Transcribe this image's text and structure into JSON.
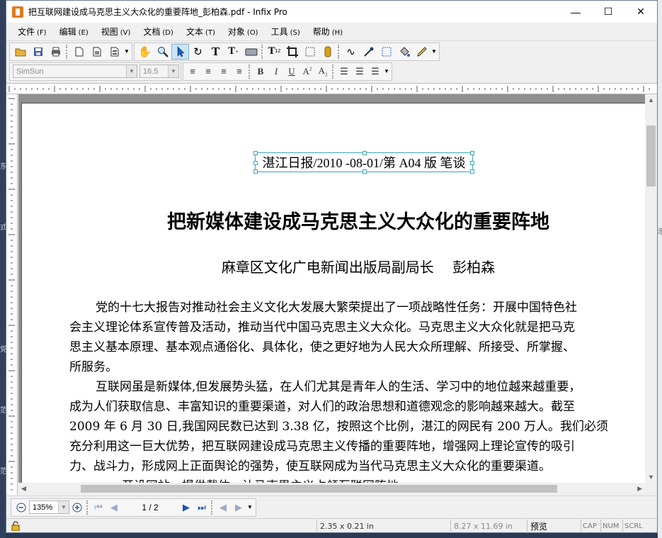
{
  "window": {
    "title": "把互联网建设成马克思主义大众化的重要阵地_彭柏森.pdf - Infix Pro",
    "minimize": "—",
    "maximize": "☐",
    "close": "✕"
  },
  "menu": [
    {
      "label": "文件",
      "accel": "(F)"
    },
    {
      "label": "编辑",
      "accel": "(E)"
    },
    {
      "label": "视图",
      "accel": "(V)"
    },
    {
      "label": "文档",
      "accel": "(D)"
    },
    {
      "label": "文本",
      "accel": "(T)"
    },
    {
      "label": "对象",
      "accel": "(O)"
    },
    {
      "label": "工具",
      "accel": "(S)"
    },
    {
      "label": "帮助",
      "accel": "(H)"
    }
  ],
  "format": {
    "font": "SimSun",
    "size": "16.5"
  },
  "document": {
    "header": "湛江日报/2010 -08-01/第 A04 版 笔谈",
    "title": "把新媒体建设成马克思主义大众化的重要阵地",
    "byline": "麻章区文化广电新闻出版局副局长　 彭柏森",
    "lines": [
      "党的十七大报告对推动社会主义文化大发展大繁荣提出了一项战略性任务：开展中国特色社",
      "会主义理论体系宣传普及活动，推动当代中国马克思主义大众化。马克思主义大众化就是把马克",
      "思主义基本原理、基本观点通俗化、具体化，使之更好地为人民大众所理解、所接受、所掌握、",
      "所服务。",
      "互联网虽是新媒体,但发展势头猛，在人们尤其是青年人的生活、学习中的地位越来越重要，",
      "成为人们获取信息、丰富知识的重要渠道，对人们的政治思想和道德观念的影响越来越大。截至",
      "2009 年 6 月 30 日,我国网民数已达到 3.38 亿，按照这个比例，湛江的网民有 200 万人。我们必须",
      "充分利用这一巨大优势，把互联网建设成马克思主义传播的重要阵地，增强网上理论宣传的吸引",
      "力、战斗力，形成网上正面舆论的强势，使互联网成为当代马克思主义大众化的重要渠道。",
      "开设网站，提供载体，让马克思主义占领互联网阵地。"
    ]
  },
  "nav": {
    "zoom": "135%",
    "page": "1 / 2"
  },
  "status": {
    "selection_size": "2.35 x 0.21 in",
    "page_size": "8.27 x 11.69 in",
    "mode": "预览",
    "cap": "CAP",
    "num": "NUM",
    "scrl": "SCRL"
  },
  "background_left": [
    "东",
    "式",
    "党",
    "范",
    "范"
  ],
  "background_right": [
    "示"
  ]
}
